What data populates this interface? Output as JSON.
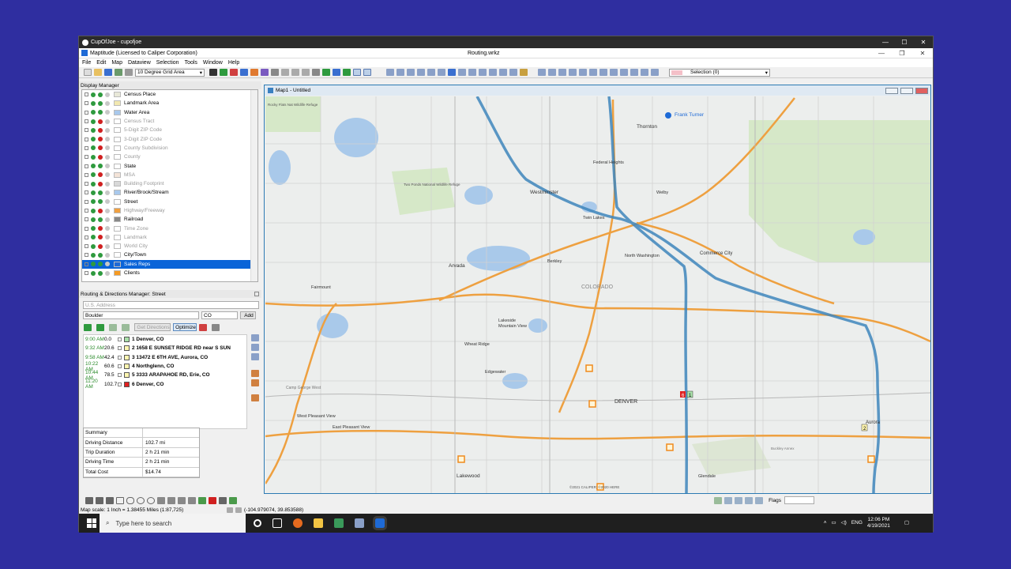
{
  "outer_window": {
    "title": "CupOfJoe - cupofjoe",
    "controls": [
      "—",
      "☐",
      "✕"
    ]
  },
  "app": {
    "title": "Maptitude (Licensed to Caliper Corporation)",
    "workspace": "Routing.wrkz",
    "controls": [
      "—",
      "❐",
      "✕"
    ]
  },
  "menu": [
    "File",
    "Edit",
    "Map",
    "Dataview",
    "Selection",
    "Tools",
    "Window",
    "Help"
  ],
  "toolbar": {
    "grid_combo": "10 Degree Grid Area",
    "selection_combo": "Selection (0)"
  },
  "display_manager": {
    "title": "Display Manager",
    "layers": [
      {
        "name": "Census Place",
        "visible": true,
        "swatch": "#e8e8d8"
      },
      {
        "name": "Landmark Area",
        "visible": true,
        "swatch": "#f2e8b0"
      },
      {
        "name": "Water Area",
        "visible": true,
        "swatch": "#a8c8ec"
      },
      {
        "name": "Census Tract",
        "visible": false,
        "swatch": "#ffffff"
      },
      {
        "name": "5-Digit ZIP Code",
        "visible": false,
        "swatch": "#ffffff"
      },
      {
        "name": "3-Digit ZIP Code",
        "visible": false,
        "swatch": "#ffffff"
      },
      {
        "name": "County Subdivision",
        "visible": false,
        "swatch": "#ffffff"
      },
      {
        "name": "County",
        "visible": false,
        "swatch": "#ffffff"
      },
      {
        "name": "State",
        "visible": true,
        "swatch": "#ffffff"
      },
      {
        "name": "MSA",
        "visible": false,
        "swatch": "#f4e4d8"
      },
      {
        "name": "Building Footprint",
        "visible": false,
        "swatch": "#d8d8d8"
      },
      {
        "name": "River/Brook/Stream",
        "visible": true,
        "swatch": "#a8c8ec"
      },
      {
        "name": "Street",
        "visible": true,
        "swatch": "#ffffff"
      },
      {
        "name": "Highway/Freeway",
        "visible": false,
        "swatch": "#f0a040"
      },
      {
        "name": "Railroad",
        "visible": true,
        "swatch": "#888888"
      },
      {
        "name": "Time Zone",
        "visible": false,
        "swatch": "#ffffff"
      },
      {
        "name": "Landmark",
        "visible": false,
        "swatch": "#ffffff"
      },
      {
        "name": "World City",
        "visible": false,
        "swatch": "#ffffff"
      },
      {
        "name": "City/Town",
        "visible": true,
        "swatch": "#ffffff"
      },
      {
        "name": "Sales Reps",
        "visible": true,
        "swatch": "#1e6ad6",
        "selected": true
      },
      {
        "name": "Clients",
        "visible": true,
        "swatch": "#f59a23"
      }
    ]
  },
  "routing": {
    "title": "Routing & Directions Manager: Street",
    "address_placeholder": "U.S. Address",
    "city": "Boulder",
    "state": "CO",
    "add_label": "Add",
    "get_directions_label": "Get Directions",
    "optimize_label": "Optimize",
    "stops": [
      {
        "time": "9:00 AM",
        "miles": "0.0",
        "label": "1 Denver, CO",
        "color": "#a8e0a8"
      },
      {
        "time": "9:32 AM",
        "miles": "20.6",
        "label": "2 1658 E SUNSET RIDGE RD near S SUN",
        "color": "#fff6b0"
      },
      {
        "time": "9:58 AM",
        "miles": "42.4",
        "label": "3 13472 E 6TH AVE, Aurora, CO",
        "color": "#fff6b0"
      },
      {
        "time": "10:22 AM",
        "miles": "60.6",
        "label": "4 Northglenn, CO",
        "color": "#fff6b0"
      },
      {
        "time": "10:44 AM",
        "miles": "78.5",
        "label": "5 3333 ARAPAHOE RD, Erie, CO",
        "color": "#fff6b0"
      },
      {
        "time": "11:20 AM",
        "miles": "102.7",
        "label": "6 Denver, CO",
        "color": "#e02020"
      }
    ],
    "summary": [
      {
        "label": "Summary",
        "value": ""
      },
      {
        "label": "Driving Distance",
        "value": "102.7 mi"
      },
      {
        "label": "Trip Duration",
        "value": "2 h 21 min"
      },
      {
        "label": "Driving Time",
        "value": "2 h 21 min"
      },
      {
        "label": "Total Cost",
        "value": "$14.74"
      }
    ]
  },
  "map": {
    "title": "Map1 - Untitled",
    "places": {
      "thornton": "Thornton",
      "frank_turner": "Frank Turner",
      "federal_heights": "Federal Heights",
      "westminster": "Westminster",
      "welby": "Welby",
      "twin_lakes": "Twin Lakes",
      "commerce_city": "Commerce City",
      "north_washington": "North Washington",
      "berkley": "Berkley",
      "arvada": "Arvada",
      "fairmount": "Fairmount",
      "colorado": "COLORADO",
      "lakeside": "Lakeside",
      "mountain_view": "Mountain View",
      "wheat_ridge": "Wheat Ridge",
      "edgewater": "Edgewater",
      "camp_george_west": "Camp George West",
      "denver": "DENVER",
      "west_pleasant_view": "West Pleasant View",
      "east_pleasant_view": "East Pleasant View",
      "aurora": "Aurora",
      "lakewood": "Lakewood",
      "glendale": "Glendale",
      "two_ponds": "Two Ponds National Wildlife Refuge",
      "rocky_flats": "Rocky Flats Nat Wildlife Refuge",
      "buckley": "Buckley Annex",
      "copyright": "©2021 CALIPER; ©2020 HERE"
    },
    "stop_numbers": [
      "1",
      "2",
      "6"
    ]
  },
  "status": {
    "scale": "Map scale: 1 Inch = 1.38455 Miles (1:87,725)",
    "coords": "(-104.979074, 39.853588)",
    "flags_label": "Flags"
  },
  "taskbar": {
    "search_placeholder": "Type here to search",
    "lang": "ENG",
    "time": "12:06 PM",
    "date": "4/19/2021"
  }
}
